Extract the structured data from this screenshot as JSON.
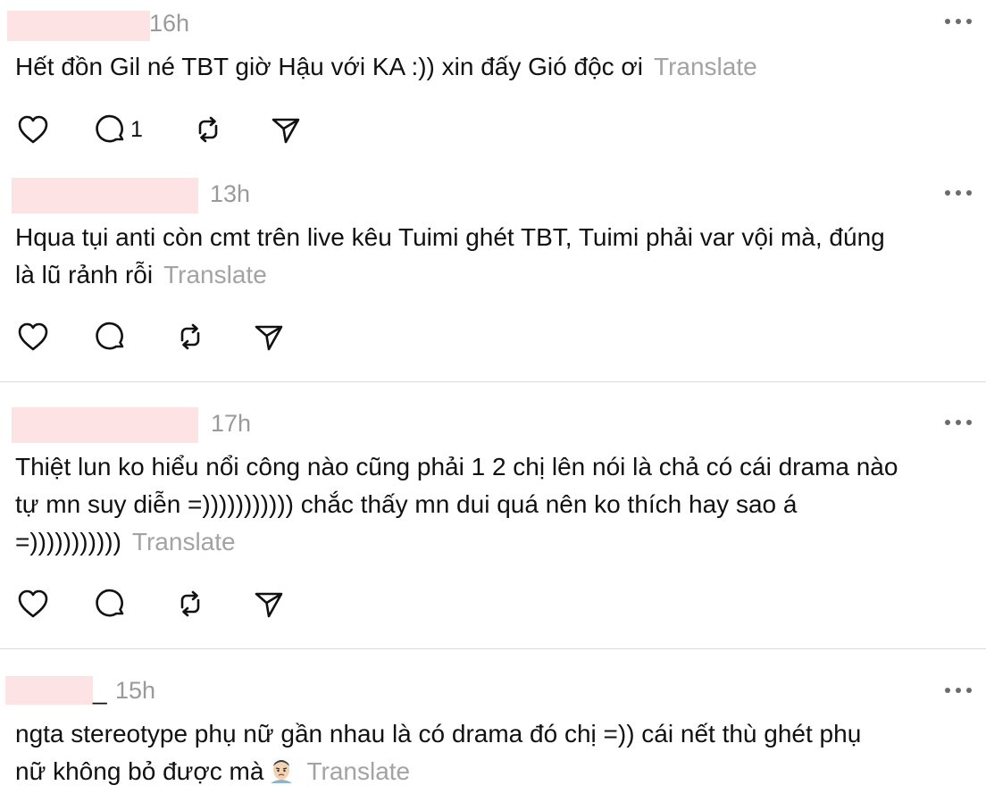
{
  "posts": [
    {
      "time": "16h",
      "text": "Hết đồn Gil né TBT giờ Hậu với KA :)) xin đấy Gió độc ơi",
      "translate": "Translate",
      "reply_count": "1"
    },
    {
      "time": "13h",
      "text_line1": "Hqua tụi anti còn cmt trên live kêu Tuimi ghét TBT, Tuimi phải var vội mà, đúng",
      "text_line2": "là lũ rảnh rỗi",
      "translate": "Translate"
    },
    {
      "time": "17h",
      "text_line1": "Thiệt lun ko hiểu nổi công nào cũng phải 1 2 chị lên nói là chả có cái drama nào",
      "text_line2": "tự mn suy diễn =))))))))))) chắc thấy mn dui quá nên ko thích hay sao á",
      "text_line3": "=)))))))))))",
      "translate": "Translate"
    },
    {
      "time": "15h",
      "username_suffix": "_",
      "text_line1": "ngta stereotype phụ nữ gần nhau là có drama đó chị =)) cái nết thù ghét phụ",
      "text_line2": "nữ không bỏ được mà",
      "translate": "Translate"
    }
  ],
  "icons": [
    "more-icon",
    "heart-icon",
    "comment-icon",
    "repost-icon",
    "share-icon",
    "face-emoji-icon"
  ],
  "colors": {
    "text": "#111111",
    "muted": "#9a9a9a",
    "redaction": "#fde3e3",
    "divider": "#dcdcdc"
  }
}
